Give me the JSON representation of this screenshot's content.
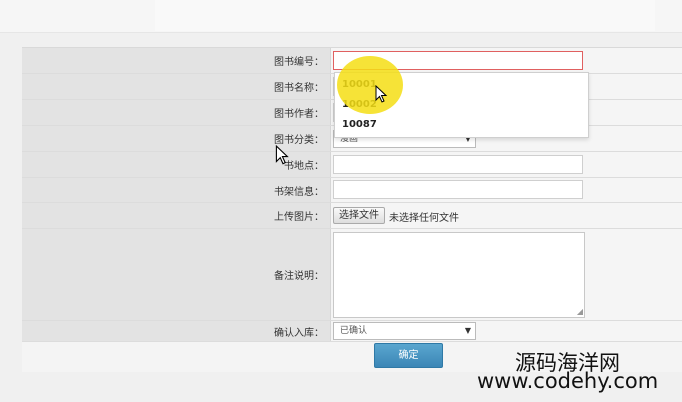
{
  "form": {
    "fields": {
      "book_id": {
        "label": "图书编号："
      },
      "book_name": {
        "label": "图书名称："
      },
      "book_author": {
        "label": "图书作者："
      },
      "book_category": {
        "label": "图书分类：",
        "selected": "漫画"
      },
      "book_location": {
        "label": "书地点："
      },
      "shelf_info": {
        "label": "书架信息："
      },
      "upload_image": {
        "label": "上传图片：",
        "button": "选择文件",
        "status": "未选择任何文件"
      },
      "remarks": {
        "label": "备注说明："
      },
      "confirm_stock": {
        "label": "确认入库：",
        "selected": "已确认"
      }
    },
    "submit_label": "确定"
  },
  "autocomplete": {
    "options": [
      "10001",
      "10002",
      "10087"
    ]
  },
  "watermark": {
    "line1": "源码海洋网",
    "line2": "www.codehy.com"
  },
  "colors": {
    "error_border": "#e06060",
    "button": "#3b86b6",
    "highlight": "#f4de14"
  }
}
